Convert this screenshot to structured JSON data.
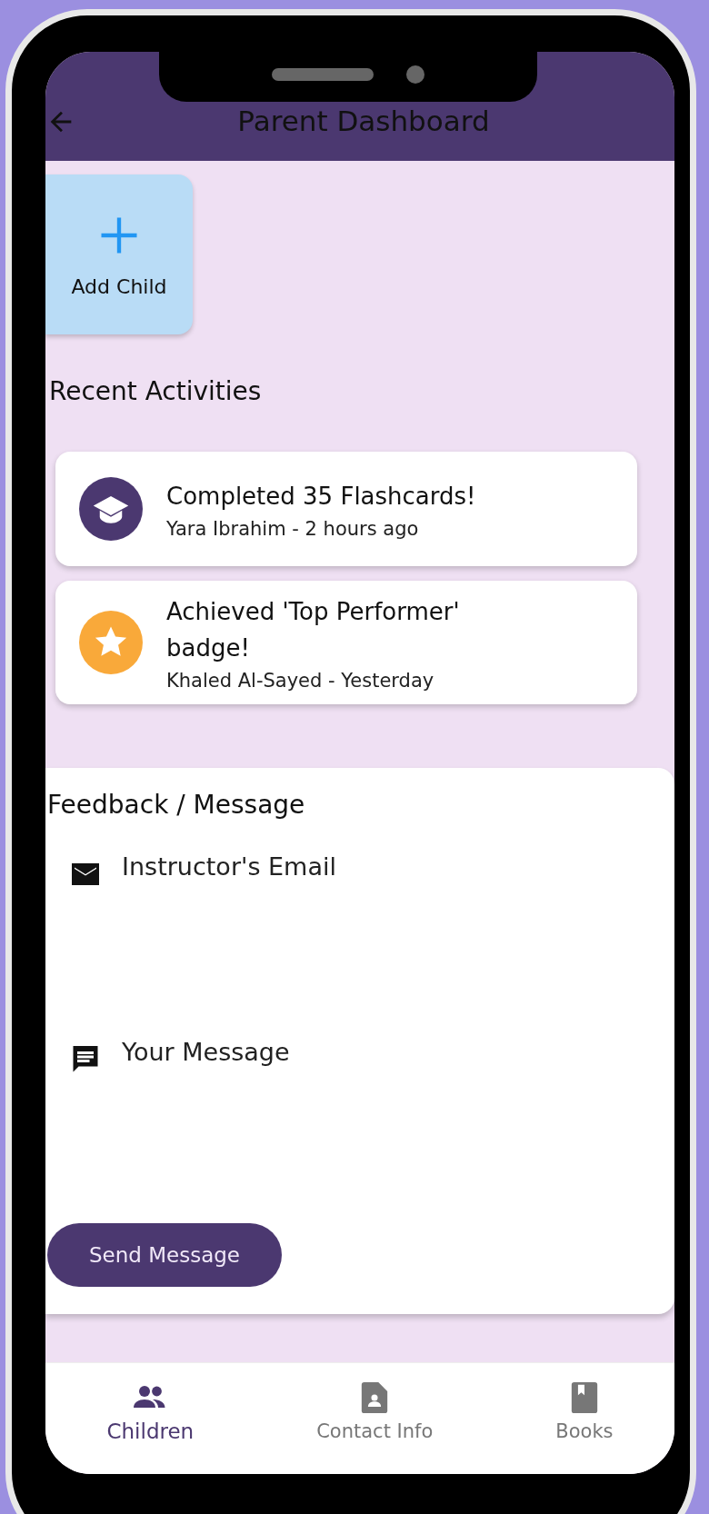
{
  "app_bar": {
    "title": "Parent Dashboard"
  },
  "add_child": {
    "label": "Add Child"
  },
  "recent_activities": {
    "title": "Recent Activities",
    "items": [
      {
        "kind": "flashcards",
        "title": "Completed 35 Flashcards!",
        "subtitle": "Yara Ibrahim - 2 hours ago",
        "color": "#4b3870"
      },
      {
        "kind": "badge",
        "title": "Achieved 'Top Performer' badge!",
        "subtitle": "Khaled Al-Sayed - Yesterday",
        "color": "#f9a93a"
      }
    ]
  },
  "feedback": {
    "title": "Feedback / Message",
    "fields": [
      {
        "kind": "email",
        "placeholder": "Instructor's Email"
      },
      {
        "kind": "message",
        "placeholder": "Your Message"
      }
    ],
    "button": "Send Message"
  },
  "bottom_nav": [
    {
      "kind": "children",
      "label": "Children",
      "selected": true
    },
    {
      "kind": "contact",
      "label": "Contact Info",
      "selected": false
    },
    {
      "kind": "books",
      "label": "Books",
      "selected": false
    }
  ]
}
